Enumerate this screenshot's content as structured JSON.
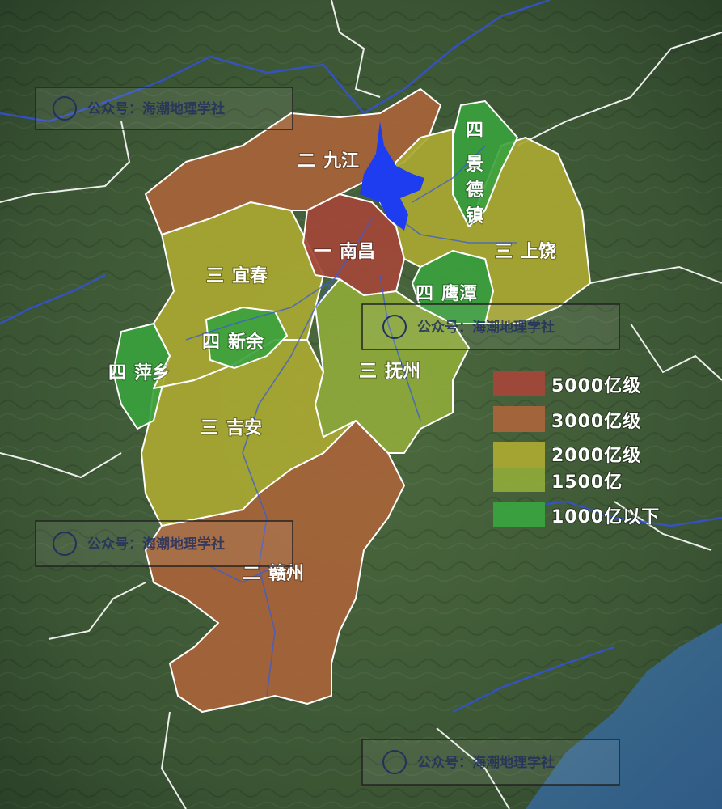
{
  "cities": [
    {
      "id": "jiujiang",
      "tier": "二",
      "name": "九江",
      "level": "3000亿级"
    },
    {
      "id": "nanchang",
      "tier": "一",
      "name": "南昌",
      "level": "5000亿级"
    },
    {
      "id": "jingdezhen",
      "tier": "四",
      "name": "景德镇",
      "level": "1000亿以下"
    },
    {
      "id": "shangrao",
      "tier": "三",
      "name": "上饶",
      "level": "2000亿级"
    },
    {
      "id": "yichun",
      "tier": "三",
      "name": "宜春",
      "level": "2000亿级"
    },
    {
      "id": "yingtan",
      "tier": "四",
      "name": "鹰潭",
      "level": "1000亿以下"
    },
    {
      "id": "xinyu",
      "tier": "四",
      "name": "新余",
      "level": "1000亿以下"
    },
    {
      "id": "pingxiang",
      "tier": "四",
      "name": "萍乡",
      "level": "1000亿以下"
    },
    {
      "id": "fuzhou",
      "tier": "三",
      "name": "抚州",
      "level": "1500亿"
    },
    {
      "id": "jian",
      "tier": "三",
      "name": "吉安",
      "level": "2000亿级"
    },
    {
      "id": "ganzhou",
      "tier": "二",
      "name": "赣州",
      "level": "3000亿级"
    }
  ],
  "legend": [
    {
      "label": "5000亿级",
      "color": "#a3473a"
    },
    {
      "label": "3000亿级",
      "color": "#a8643a"
    },
    {
      "label": "2000亿级",
      "color": "#a9a832"
    },
    {
      "label": "1500亿",
      "color": "#8da93a"
    },
    {
      "label": "1000亿以下",
      "color": "#3aa23e"
    }
  ],
  "watermark": {
    "text": "公众号：海潮地理学社"
  },
  "colors": {
    "lake": "#1f3df0",
    "border": "#ffffff",
    "river": "#3a5bd8"
  }
}
